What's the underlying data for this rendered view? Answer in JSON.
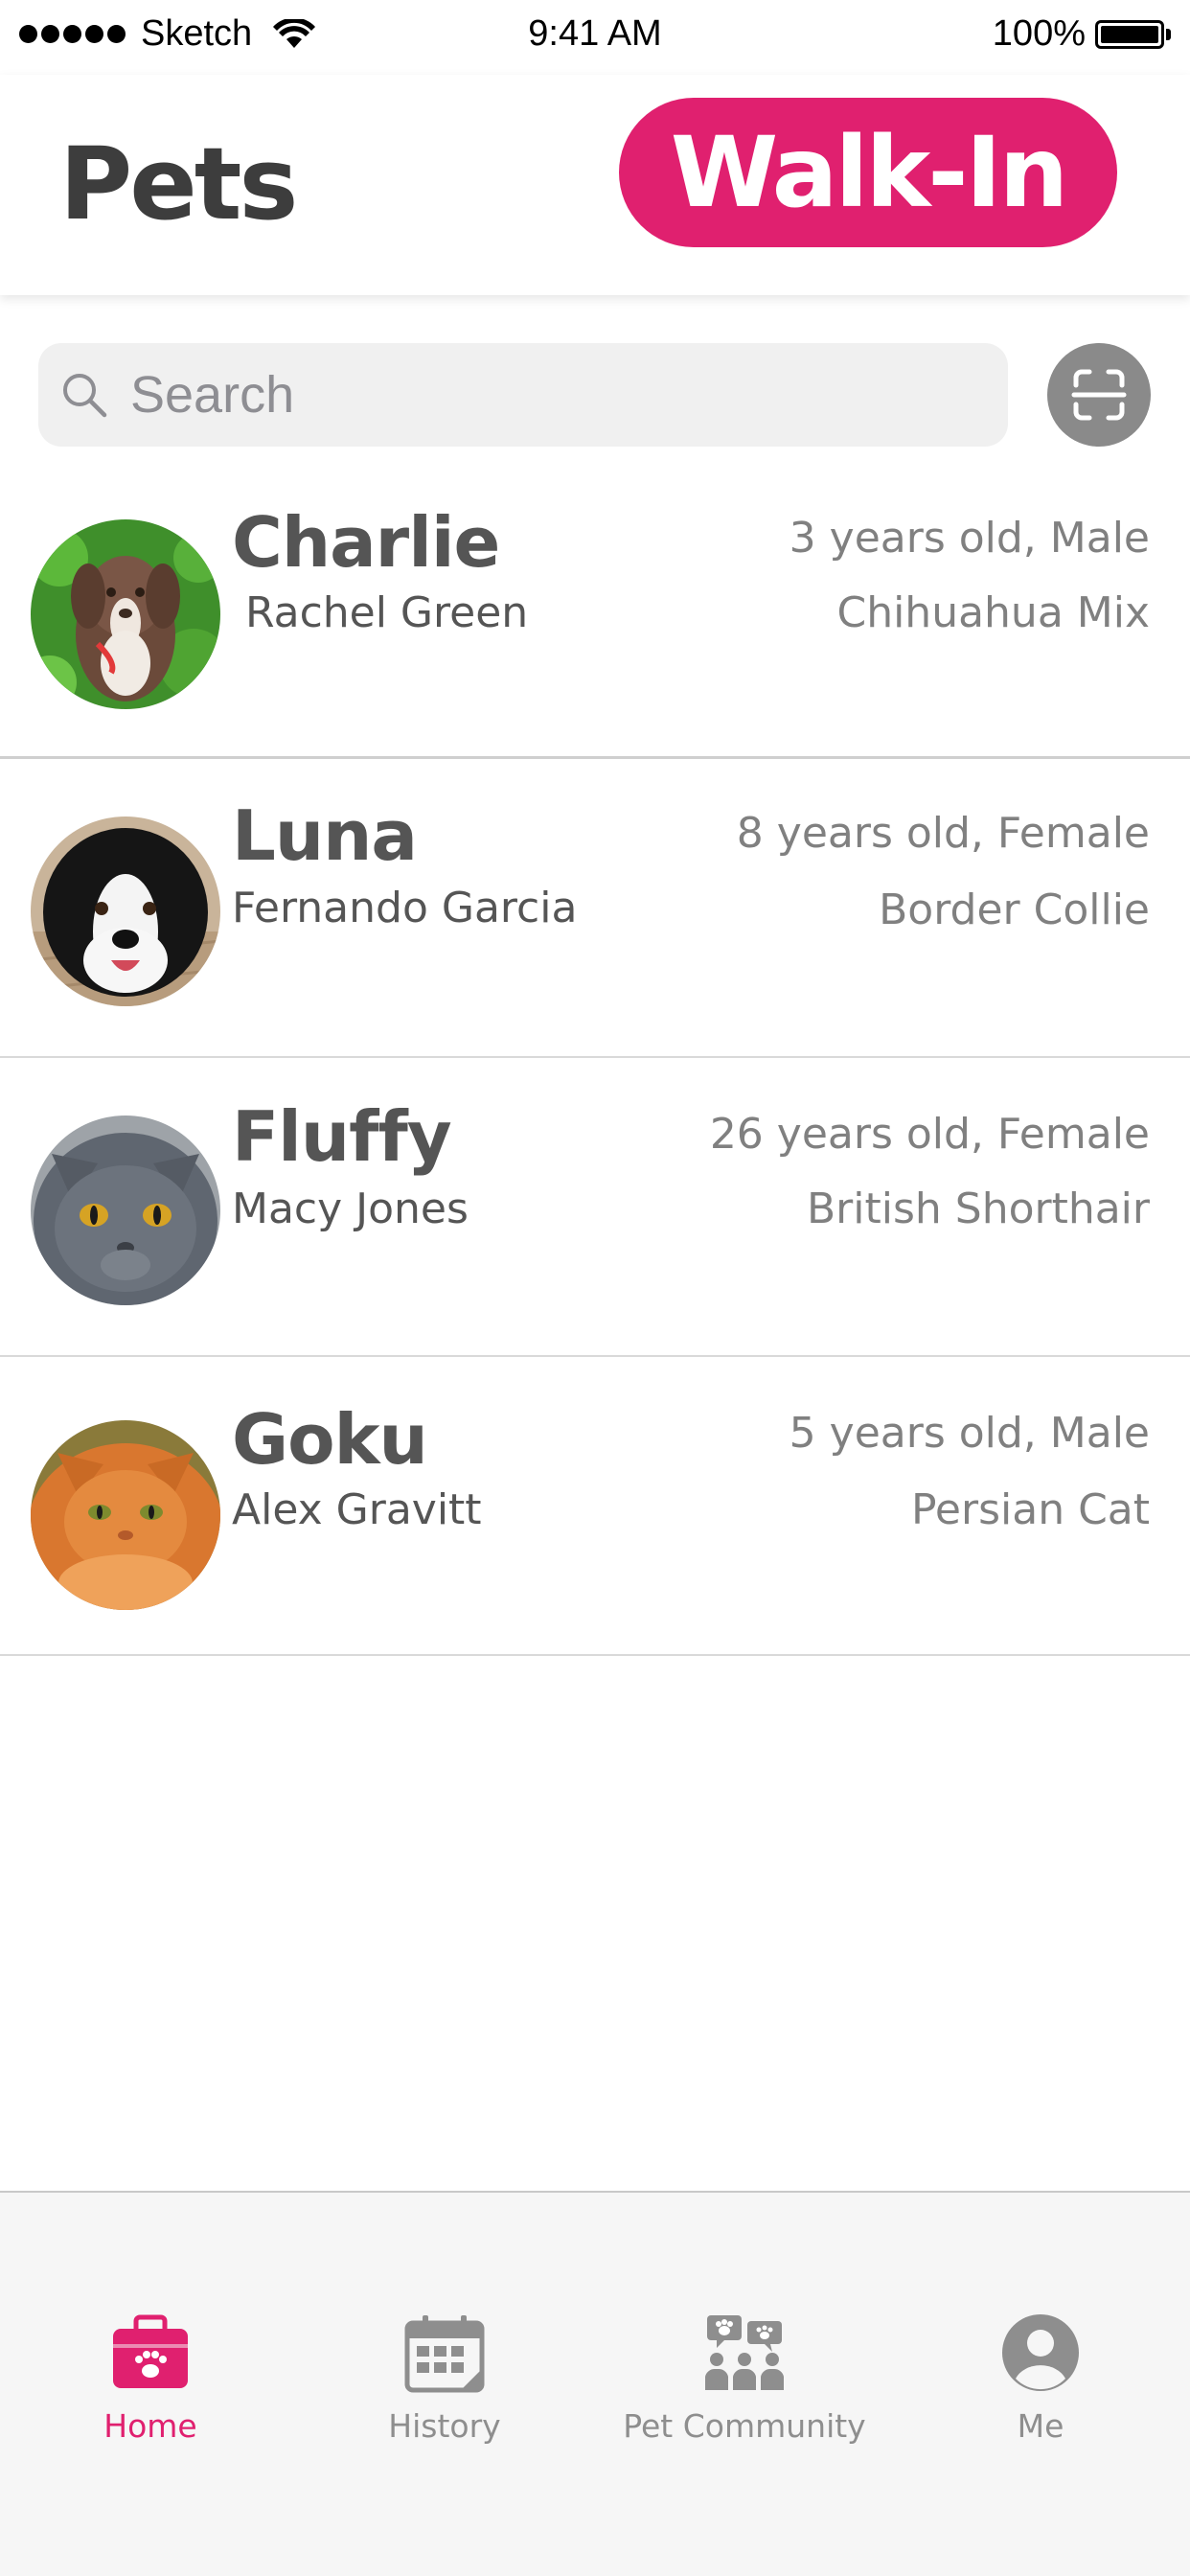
{
  "status_bar": {
    "carrier": "Sketch",
    "time": "9:41 AM",
    "battery": "100%"
  },
  "header": {
    "title": "Pets",
    "walkin_label": "Walk-In"
  },
  "search": {
    "placeholder": "Search"
  },
  "pets": [
    {
      "name": "Charlie",
      "owner": "Rachel Green",
      "age": "3 years old, Male",
      "breed": "Chihuahua Mix"
    },
    {
      "name": "Luna",
      "owner": "Fernando Garcia",
      "age": "8 years old, Female",
      "breed": "Border Collie"
    },
    {
      "name": "Fluffy",
      "owner": "Macy Jones",
      "age": "26 years old, Female",
      "breed": "British Shorthair"
    },
    {
      "name": "Goku",
      "owner": "Alex Gravitt",
      "age": "5 years old, Male",
      "breed": "Persian Cat"
    }
  ],
  "tabs": [
    {
      "label": "Home",
      "icon": "pet-bag-icon",
      "active": true
    },
    {
      "label": "History",
      "icon": "calendar-icon",
      "active": false
    },
    {
      "label": "Pet Community",
      "icon": "community-icon",
      "active": false
    },
    {
      "label": "Me",
      "icon": "profile-icon",
      "active": false
    }
  ],
  "colors": {
    "accent": "#e0206f",
    "text_dark": "#555555",
    "text_muted": "#808080",
    "tab_inactive": "#8e8e8e"
  }
}
